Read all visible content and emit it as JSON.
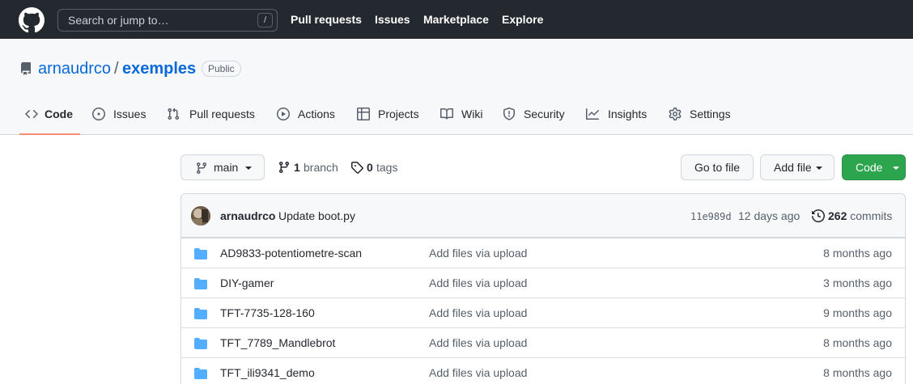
{
  "header": {
    "search_placeholder": "Search or jump to…",
    "search_shortcut": "/",
    "nav": [
      "Pull requests",
      "Issues",
      "Marketplace",
      "Explore"
    ]
  },
  "repo": {
    "owner": "arnaudrco",
    "separator": "/",
    "name": "exemples",
    "visibility": "Public"
  },
  "tabs": [
    {
      "label": "Code",
      "icon": "code-icon",
      "active": true
    },
    {
      "label": "Issues",
      "icon": "issue-icon"
    },
    {
      "label": "Pull requests",
      "icon": "pull-request-icon"
    },
    {
      "label": "Actions",
      "icon": "play-icon"
    },
    {
      "label": "Projects",
      "icon": "table-icon"
    },
    {
      "label": "Wiki",
      "icon": "book-icon"
    },
    {
      "label": "Security",
      "icon": "shield-icon"
    },
    {
      "label": "Insights",
      "icon": "graph-icon"
    },
    {
      "label": "Settings",
      "icon": "gear-icon"
    }
  ],
  "toolbar": {
    "branch": "main",
    "branch_count": "1",
    "branch_label": "branch",
    "tag_count": "0",
    "tag_label": "tags",
    "goto_file": "Go to file",
    "add_file": "Add file",
    "code": "Code"
  },
  "commit": {
    "author": "arnaudrco",
    "message": "Update boot.py",
    "sha": "11e989d",
    "date": "12 days ago",
    "count": "262",
    "count_label": "commits"
  },
  "files": [
    {
      "name": "AD9833-potentiometre-scan",
      "message": "Add files via upload",
      "age": "8 months ago"
    },
    {
      "name": "DIY-gamer",
      "message": "Add files via upload",
      "age": "3 months ago"
    },
    {
      "name": "TFT-7735-128-160",
      "message": "Add files via upload",
      "age": "9 months ago"
    },
    {
      "name": "TFT_7789_Mandlebrot",
      "message": "Add files via upload",
      "age": "8 months ago"
    },
    {
      "name": "TFT_ili9341_demo",
      "message": "Add files via upload",
      "age": "8 months ago"
    }
  ],
  "colors": {
    "header_bg": "#24292f",
    "link": "#0969da",
    "folder": "#54aeff",
    "green_button": "#2da44e",
    "active_tab_underline": "#fd8c73"
  }
}
